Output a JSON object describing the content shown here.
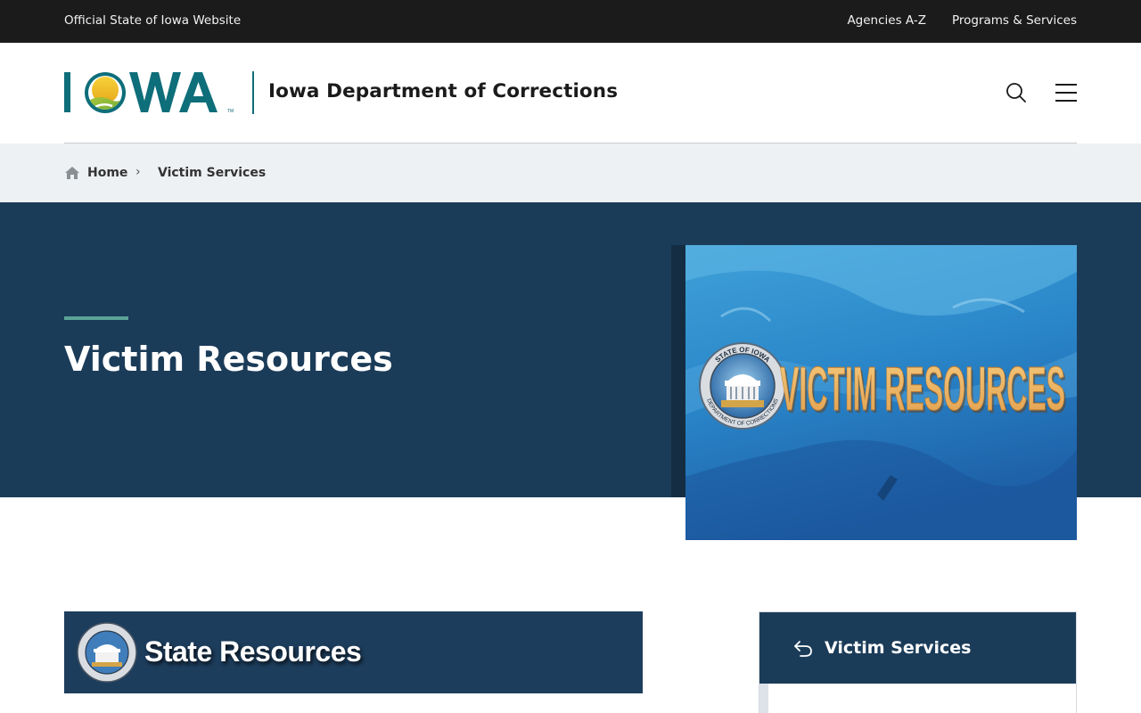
{
  "utility": {
    "official_text": "Official State of Iowa Website",
    "links": [
      "Agencies A-Z",
      "Programs & Services"
    ]
  },
  "header": {
    "logo_text": "IOWA",
    "agency_name": "Iowa Department of Corrections",
    "search_icon": "search-icon",
    "menu_icon": "hamburger-menu-icon"
  },
  "breadcrumb": {
    "home": "Home",
    "separator": "›",
    "current": "Victim Services"
  },
  "hero": {
    "title": "Victim Resources",
    "image_text": "VICTIM RESOURCES",
    "seal_top": "STATE OF IOWA",
    "seal_bottom": "DEPARTMENT OF CORRECTIONS"
  },
  "state_banner": {
    "title": "State Resources"
  },
  "side_nav": {
    "title": "Victim Services",
    "icon": "back-arrow-icon"
  },
  "colors": {
    "utility_bar": "#1b1b1b",
    "brand_teal": "#0e6e7a",
    "hero_navy": "#1b3c59",
    "accent_green": "#5ba396",
    "breadcrumb_bg": "#edf1f3",
    "logo_gold": "#f4c21b"
  }
}
